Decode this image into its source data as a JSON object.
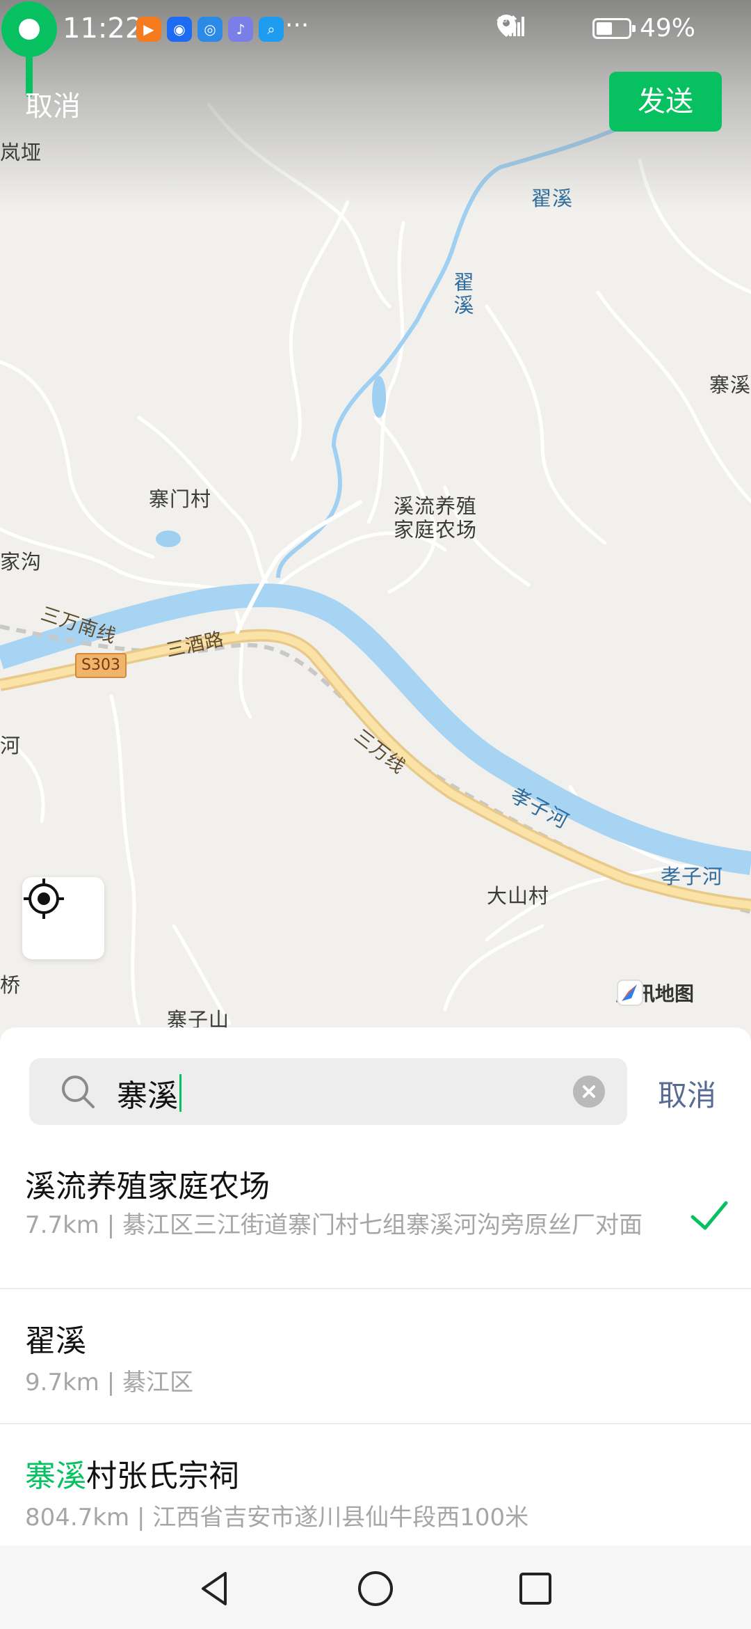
{
  "status_bar": {
    "time": "11:22",
    "apps": [
      {
        "name": "video-app-icon",
        "color": "#f47b20",
        "glyph": "▶"
      },
      {
        "name": "bulb-app-icon",
        "color": "#1d6bf3",
        "glyph": "◉"
      },
      {
        "name": "browser-app-icon",
        "color": "#2b8ae6",
        "glyph": "◎"
      },
      {
        "name": "music-app-icon",
        "color": "#7a7fe8",
        "glyph": "♪"
      },
      {
        "name": "search-app-icon",
        "color": "#1e9cf0",
        "glyph": "⌕"
      }
    ],
    "more": "···",
    "network": "4G",
    "battery_percent": 49,
    "battery_text": "49%"
  },
  "header": {
    "cancel_label": "取消",
    "send_label": "发送",
    "send_color": "#07c160"
  },
  "map": {
    "place_labels": {
      "lanya": "岚垭",
      "zhaixi_river_top": "翟溪",
      "zhaixi_river_vertical": "翟溪",
      "zhaixi_right": "寨溪",
      "zhaimen_village": "寨门村",
      "jiagou": "家沟",
      "pin_label_line1": "溪流养殖",
      "pin_label_line2": "家庭农场",
      "sanwan_south": "三万南线",
      "sanjiu_road": "三酒路",
      "s303": "S303",
      "he_left": "河",
      "sanwan_line": "三万线",
      "xiaozi_river_mid": "孝子河",
      "xiaozi_river_right": "孝子河",
      "dashan_village": "大山村",
      "qiao": "桥",
      "zhaizi_mountain": "寨子山"
    },
    "provider": "腾讯地图",
    "pin_color": "#07c160"
  },
  "search": {
    "query": "寨溪",
    "cancel_label": "取消"
  },
  "results": [
    {
      "title": "溪流养殖家庭农场",
      "subtitle": "7.7km | 綦江区三江街道寨门村七组寨溪河沟旁原丝厂对面",
      "selected": true
    },
    {
      "title": "翟溪",
      "subtitle": "9.7km | 綦江区",
      "selected": false
    },
    {
      "title_highlight": "寨溪",
      "title_rest": "村张氏宗祠",
      "subtitle": "804.7km | 江西省吉安市遂川县仙牛段西100米",
      "selected": false
    }
  ]
}
